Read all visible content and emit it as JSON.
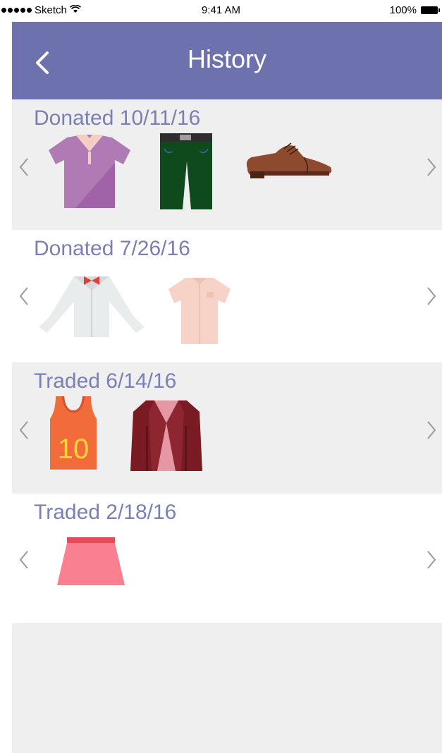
{
  "status_bar": {
    "carrier": "Sketch",
    "time": "9:41 AM",
    "battery": "100%"
  },
  "nav": {
    "title": "History",
    "back_icon": "chevron-left-icon"
  },
  "sections": [
    {
      "title": "Donated 10/11/16",
      "items": [
        "purple-polo-shirt",
        "green-trousers",
        "brown-oxford-shoe"
      ]
    },
    {
      "title": "Donated 7/26/16",
      "items": [
        "white-shirt-with-bowtie",
        "pink-short-sleeve-shirt"
      ]
    },
    {
      "title": "Traded 6/14/16",
      "items": [
        "orange-jersey-tank-top",
        "maroon-blazer"
      ]
    },
    {
      "title": "Traded 2/18/16",
      "items": [
        "pink-skirt"
      ]
    }
  ],
  "jersey_number": "10",
  "colors": {
    "nav_background": "#6d72ae",
    "section_title": "#7a7fb5",
    "gray_section": "#efefef"
  }
}
